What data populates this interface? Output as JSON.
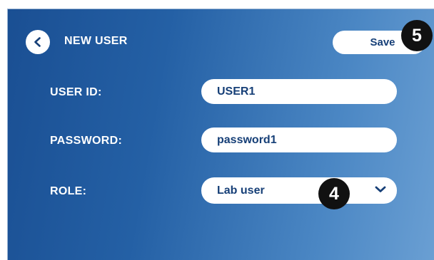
{
  "header": {
    "title": "NEW USER",
    "back_icon": "chevron-left-icon",
    "save_label": "Save"
  },
  "form": {
    "user_id": {
      "label": "USER ID:",
      "value": "USER1"
    },
    "password": {
      "label": "PASSWORD:",
      "value": "password1"
    },
    "role": {
      "label": "ROLE:",
      "value": "Lab user",
      "icon": "chevron-down-icon"
    }
  },
  "callouts": {
    "save_marker": "5",
    "role_marker": "4"
  },
  "colors": {
    "accent_text": "#163f77",
    "background_start": "#1a4f93",
    "background_end": "#6a9fd3",
    "callout": "#111111"
  }
}
